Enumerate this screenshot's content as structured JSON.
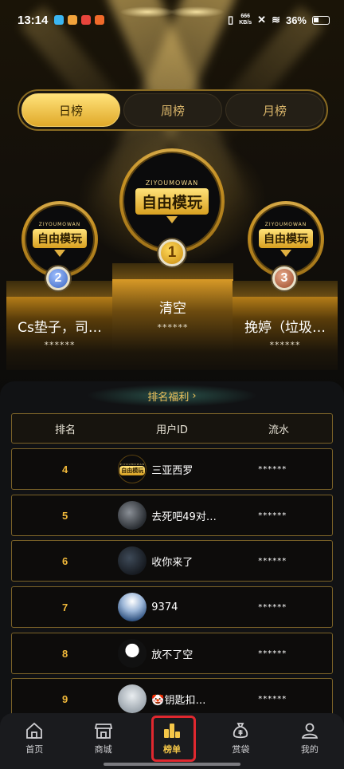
{
  "status": {
    "time": "13:14",
    "speed_top": "666",
    "speed_bottom": "KB/s",
    "battery": "36%"
  },
  "tabs": [
    {
      "label": "日榜",
      "active": true
    },
    {
      "label": "周榜",
      "active": false
    },
    {
      "label": "月榜",
      "active": false
    }
  ],
  "logo": {
    "small_text": "ZIYOUMOWAN",
    "main_text": "自由模玩"
  },
  "podium": {
    "first": {
      "rank": "1",
      "name": "清空",
      "score": "******"
    },
    "second": {
      "rank": "2",
      "name": "Cs垫子，司…",
      "score": "******"
    },
    "third": {
      "rank": "3",
      "name": "挽婷（垃圾…",
      "score": "******"
    }
  },
  "welfare_link": "排名福利 ",
  "table": {
    "headers": {
      "rank": "排名",
      "user": "用户ID",
      "flow": "流水"
    },
    "rows": [
      {
        "rank": "4",
        "name": "三亚西罗",
        "flow": "******",
        "avatar": "logo"
      },
      {
        "rank": "5",
        "name": "去死吧49对…",
        "flow": "******",
        "avatar": "dark"
      },
      {
        "rank": "6",
        "name": "收你来了",
        "flow": "******",
        "avatar": "dim"
      },
      {
        "rank": "7",
        "name": "9374",
        "flow": "******",
        "avatar": "blue"
      },
      {
        "rank": "8",
        "name": "放不了空",
        "flow": "******",
        "avatar": "bw"
      },
      {
        "rank": "9",
        "name": "🤡钥匙扣…",
        "flow": "******",
        "avatar": "light"
      }
    ]
  },
  "nav": [
    {
      "label": "首页",
      "icon": "home-icon",
      "active": false
    },
    {
      "label": "商城",
      "icon": "store-icon",
      "active": false
    },
    {
      "label": "榜单",
      "icon": "ranking-icon",
      "active": true
    },
    {
      "label": "赏袋",
      "icon": "money-bag-icon",
      "active": false
    },
    {
      "label": "我的",
      "icon": "user-icon",
      "active": false
    }
  ],
  "colors": {
    "accent": "#f4c648",
    "highlight": "#e0282f"
  }
}
